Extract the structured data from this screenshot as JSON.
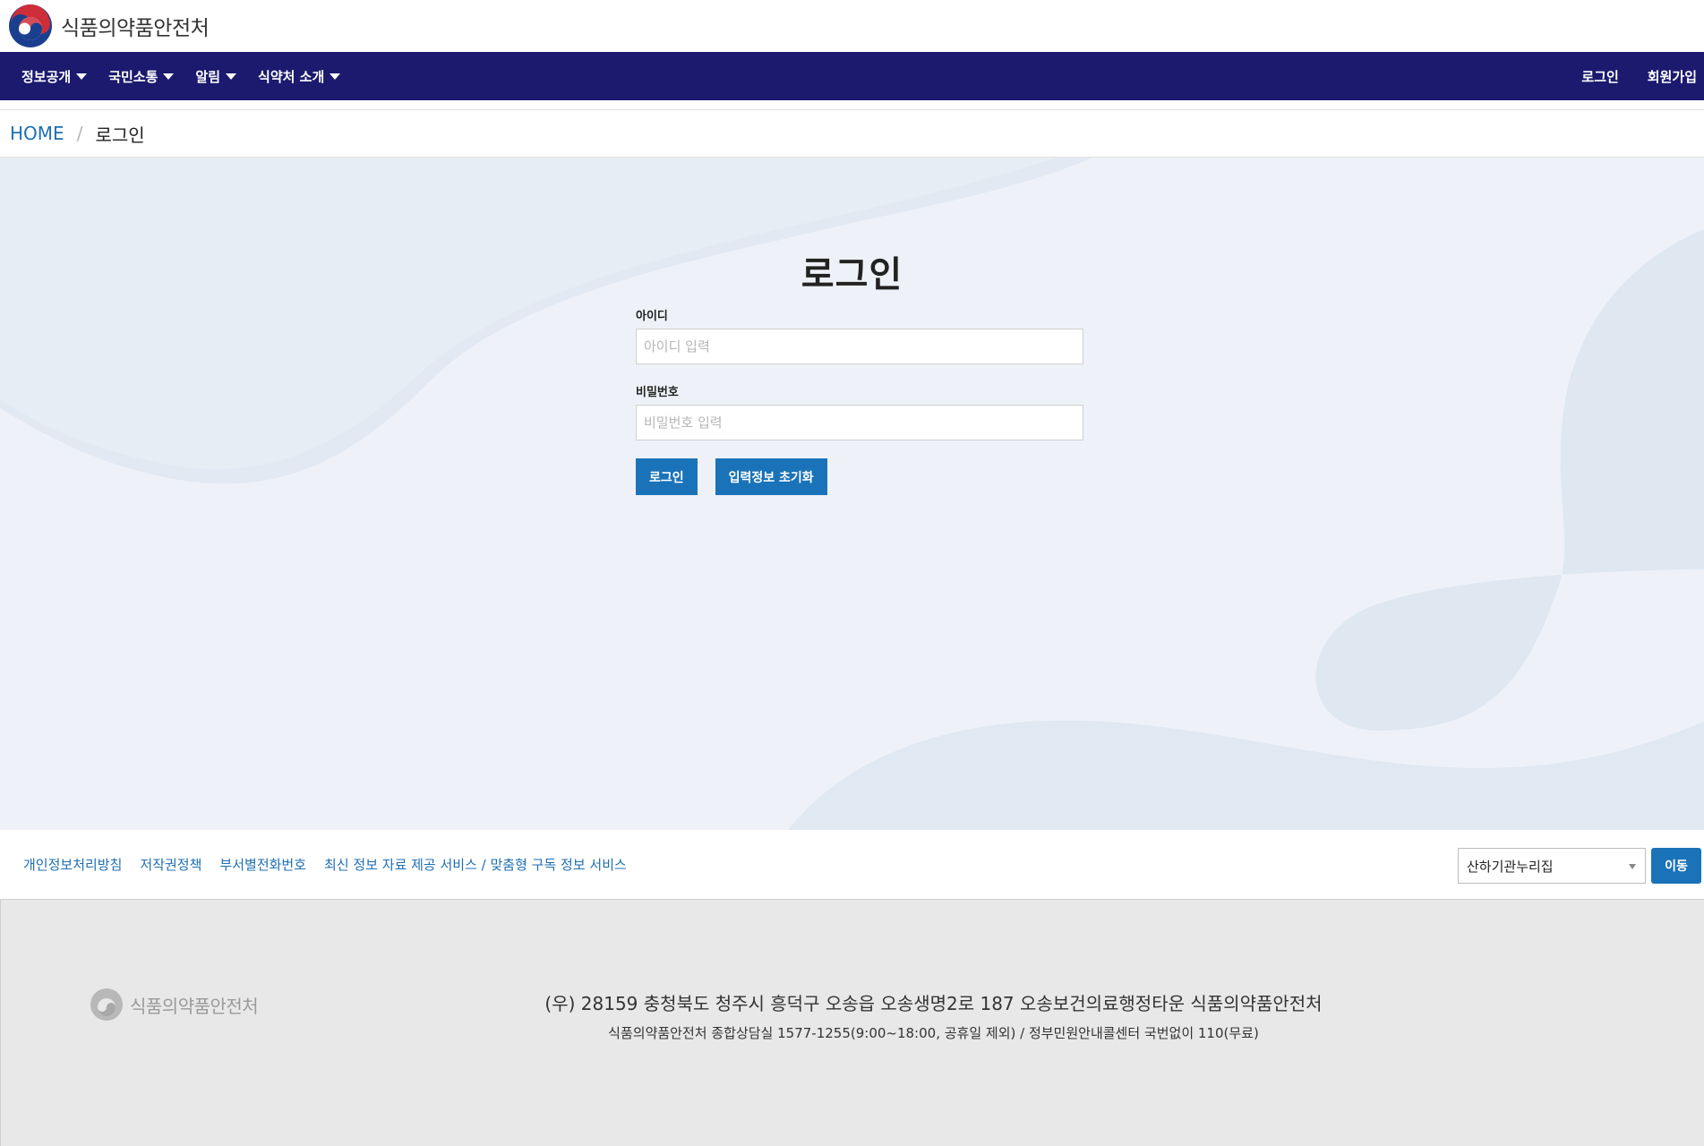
{
  "header": {
    "org_name": "식품의약품안전처"
  },
  "nav": {
    "items": [
      {
        "label": "정보공개"
      },
      {
        "label": "국민소통"
      },
      {
        "label": "알림"
      },
      {
        "label": "식약처 소개"
      }
    ],
    "login_label": "로그인",
    "signup_label": "회원가입",
    "background_color": "#1b1a6e"
  },
  "breadcrumb": {
    "home": "HOME",
    "separator": "/",
    "current": "로그인"
  },
  "login": {
    "title": "로그인",
    "id_label": "아이디",
    "id_placeholder": "아이디 입력",
    "id_value": "",
    "pw_label": "비밀번호",
    "pw_placeholder": "비밀번호 입력",
    "pw_value": "",
    "login_button": "로그인",
    "reset_button": "입력정보 초기화",
    "button_color": "#1a73b8"
  },
  "footer": {
    "links": [
      {
        "label": "개인정보처리방침"
      },
      {
        "label": "저작권정책"
      },
      {
        "label": "부서별전화번호"
      },
      {
        "label": "최신 정보 자료 제공 서비스 / 맞춤형 구독 정보 서비스"
      }
    ],
    "select_value": "산하기관누리집",
    "go_button": "이동",
    "org_name": "식품의약품안전처",
    "address": "(우) 28159 충청북도 청주시 흥덕구 오송읍 오송생명2로 187 오송보건의료행정타운 식품의약품안전처",
    "contact": "식품의약품안전처 종합상담실 1577-1255(9:00~18:00, 공휴일 제외) / 정부민원안내콜센터 국번없이 110(무료)"
  }
}
